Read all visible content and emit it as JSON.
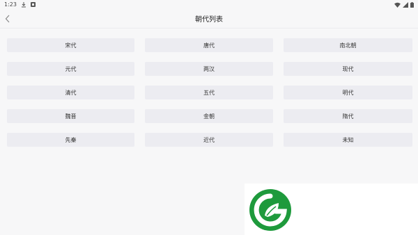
{
  "status_bar": {
    "time": "1:23",
    "icons": [
      "download-icon",
      "notification-app-icon",
      "wifi-icon",
      "signal-icon",
      "battery-icon"
    ]
  },
  "header": {
    "title": "朝代列表",
    "back_icon": "chevron-left-icon"
  },
  "dynasties": [
    "宋代",
    "唐代",
    "南北朝",
    "元代",
    "两汉",
    "现代",
    "清代",
    "五代",
    "明代",
    "魏晋",
    "金朝",
    "隋代",
    "先秦",
    "近代",
    "未知"
  ],
  "overlay": {
    "logo_icon": "green-leaf-logo-icon",
    "colors": {
      "logo_green": "#1e9a3c"
    }
  }
}
